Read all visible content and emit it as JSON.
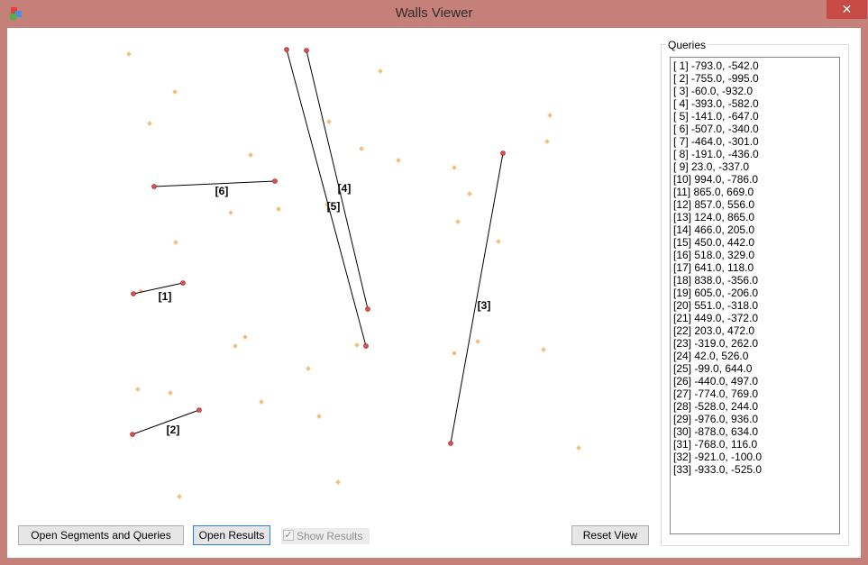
{
  "window": {
    "title": "Walls Viewer",
    "close_glyph": "✕"
  },
  "buttons": {
    "open_segments": "Open Segments and Queries",
    "open_results": "Open Results",
    "reset_view": "Reset View"
  },
  "show_results": {
    "label": "Show Results",
    "checked": true,
    "enabled": false
  },
  "queries": {
    "title": "Queries",
    "items": [
      "[ 1] -793.0, -542.0",
      "[ 2] -755.0, -995.0",
      "[ 3] -60.0, -932.0",
      "[ 4] -393.0, -582.0",
      "[ 5] -141.0, -647.0",
      "[ 6] -507.0, -340.0",
      "[ 7] -464.0, -301.0",
      "[ 8] -191.0, -436.0",
      "[ 9] 23.0, -337.0",
      "[10] 994.0, -786.0",
      "[11] 865.0, 669.0",
      "[12] 857.0, 556.0",
      "[13] 124.0, 865.0",
      "[14] 466.0, 205.0",
      "[15] 450.0, 442.0",
      "[16] 518.0, 329.0",
      "[17] 641.0, 118.0",
      "[18] 838.0, -356.0",
      "[19] 605.0, -206.0",
      "[20] 551.0, -318.0",
      "[21] 449.0, -372.0",
      "[22] 203.0, 472.0",
      "[23] -319.0, 262.0",
      "[24] 42.0, 526.0",
      "[25] -99.0, 644.0",
      "[26] -440.0, 497.0",
      "[27] -774.0, 769.0",
      "[28] -528.0, 244.0",
      "[29] -976.0, 936.0",
      "[30] -878.0, 634.0",
      "[31] -768.0, 116.0",
      "[32] -921.0, -100.0",
      "[33] -933.0, -525.0"
    ]
  },
  "canvas": {
    "segment_labels": [
      "[1]",
      "[2]",
      "[3]",
      "[4]",
      "[5]",
      "[6]"
    ],
    "segment_color": "#000000",
    "endpoint_color": "#e05050",
    "query_point_color": "#f0c080"
  }
}
